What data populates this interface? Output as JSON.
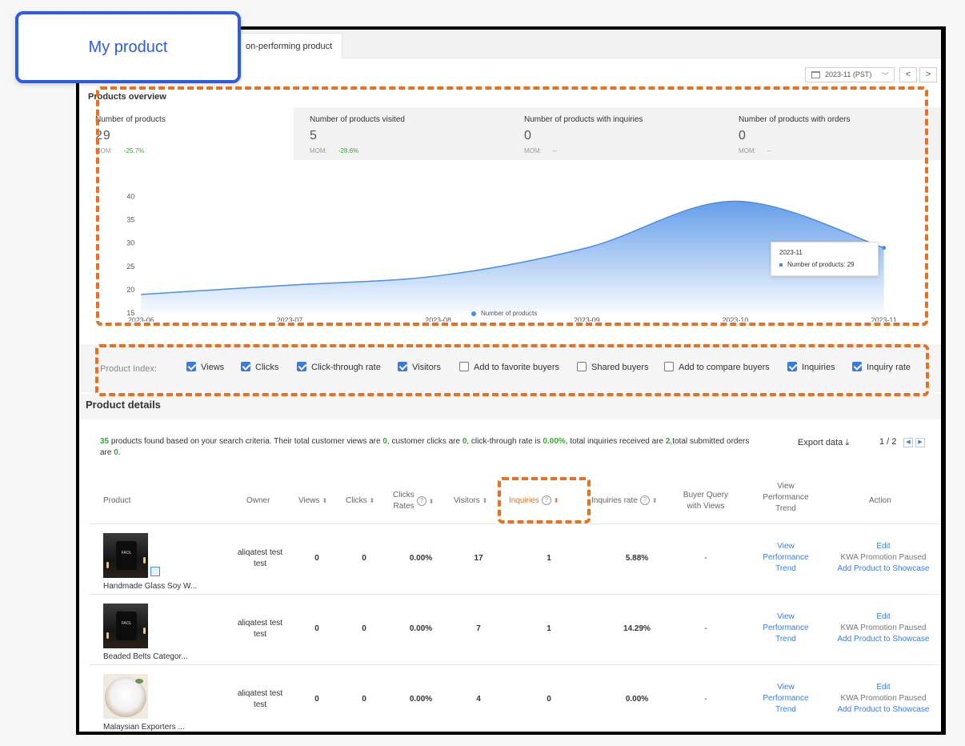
{
  "tabs": {
    "my_product": "My product",
    "underperforming": "on-performing product"
  },
  "date_selector": {
    "value": "2023-11 (PST)",
    "prev": "<",
    "next": ">"
  },
  "overview": {
    "title": "Products overview",
    "metrics": [
      {
        "label": "Number of products",
        "value": "29",
        "mom_label": "MOM:",
        "mom": "-25.7%"
      },
      {
        "label": "Number of products visited",
        "value": "5",
        "mom_label": "MOM:",
        "mom": "-28.6%"
      },
      {
        "label": "Number of products with inquiries",
        "value": "0",
        "mom_label": "MOM:",
        "mom": "--"
      },
      {
        "label": "Number of products with orders",
        "value": "0",
        "mom_label": "MOM:",
        "mom": "--"
      }
    ]
  },
  "chart_data": {
    "type": "area",
    "x": [
      "2023-06",
      "2023-07",
      "2023-08",
      "2023-09",
      "2023-10",
      "2023-11"
    ],
    "series": [
      {
        "name": "Number of products",
        "values": [
          19,
          21,
          23,
          29,
          39,
          29
        ]
      }
    ],
    "yticks": [
      15,
      20,
      25,
      30,
      35,
      40
    ],
    "ylim": [
      15,
      40
    ],
    "tooltip": {
      "title": "2023-11",
      "label": "Number of products: 29"
    },
    "legend": "bottom-center",
    "color": "#4a8de6"
  },
  "index_filter": {
    "label": "Product Index:",
    "items": [
      {
        "label": "Views",
        "checked": true
      },
      {
        "label": "Clicks",
        "checked": true
      },
      {
        "label": "Click-through rate",
        "checked": true
      },
      {
        "label": "Visitors",
        "checked": true
      },
      {
        "label": "Add to favorite buyers",
        "checked": false
      },
      {
        "label": "Shared buyers",
        "checked": false
      },
      {
        "label": "Add to compare buyers",
        "checked": false
      },
      {
        "label": "Inquiries",
        "checked": true
      },
      {
        "label": "Inquiry rate",
        "checked": true
      }
    ]
  },
  "details": {
    "title": "Product details",
    "summary": {
      "count": "35",
      "t1": " products found based on your search criteria. Their total customer views are ",
      "views": "0",
      "t2": ", customer clicks are ",
      "clicks": "0",
      "t3": ", click-through rate is ",
      "ctr": "0.00%",
      "t4": ", total inquiries received are ",
      "inquiries": "2",
      "t5": ",total submitted orders are ",
      "orders": "0",
      "t6": "."
    },
    "export_label": "Export data",
    "page": "1 / 2",
    "columns": {
      "product": "Product",
      "owner": "Owner",
      "views": "Views",
      "clicks": "Clicks",
      "clicks_rates_1": "Clicks",
      "clicks_rates_2": "Rates",
      "visitors": "Visitors",
      "inquiries": "Inquiries",
      "inquiries_rate": "Inquiries rate",
      "buyer_query_1": "Buyer Query",
      "buyer_query_2": "with Views",
      "vpt_1": "View",
      "vpt_2": "Performance",
      "vpt_3": "Trend",
      "action": "Action"
    },
    "rows": [
      {
        "name": "Handmade Glass Soy W...",
        "owner_1": "aliqatest test",
        "owner_2": "test",
        "views": "0",
        "clicks": "0",
        "rate": "0.00%",
        "visitors": "17",
        "inquiries": "1",
        "inq_rate": "5.88%",
        "buyer_query": "-",
        "vpt_1": "View",
        "vpt_2": "Performance",
        "vpt_3": "Trend",
        "edit": "Edit",
        "status": "KWA Promotion Paused",
        "showcase": "Add Product to Showcase"
      },
      {
        "name": "Beaded Belts Categor...",
        "owner_1": "aliqatest test",
        "owner_2": "test",
        "views": "0",
        "clicks": "0",
        "rate": "0.00%",
        "visitors": "7",
        "inquiries": "1",
        "inq_rate": "14.29%",
        "buyer_query": "-",
        "vpt_1": "View",
        "vpt_2": "Performance",
        "vpt_3": "Trend",
        "edit": "Edit",
        "status": "KWA Promotion Paused",
        "showcase": "Add Product to Showcase"
      },
      {
        "name": "Malaysian Exporters ...",
        "owner_1": "aliqatest test",
        "owner_2": "test",
        "views": "0",
        "clicks": "0",
        "rate": "0.00%",
        "visitors": "4",
        "inquiries": "0",
        "inq_rate": "0.00%",
        "buyer_query": "-",
        "vpt_1": "View",
        "vpt_2": "Performance",
        "vpt_3": "Trend",
        "edit": "Edit",
        "status": "KWA Promotion Paused",
        "showcase": "Add Product to Showcase"
      }
    ],
    "jar_text": "FAOL"
  },
  "colors": {
    "accent": "#3b7be0",
    "highlight": "#e8701f",
    "focus": "#2d5be3",
    "positive": "#2db02d"
  }
}
